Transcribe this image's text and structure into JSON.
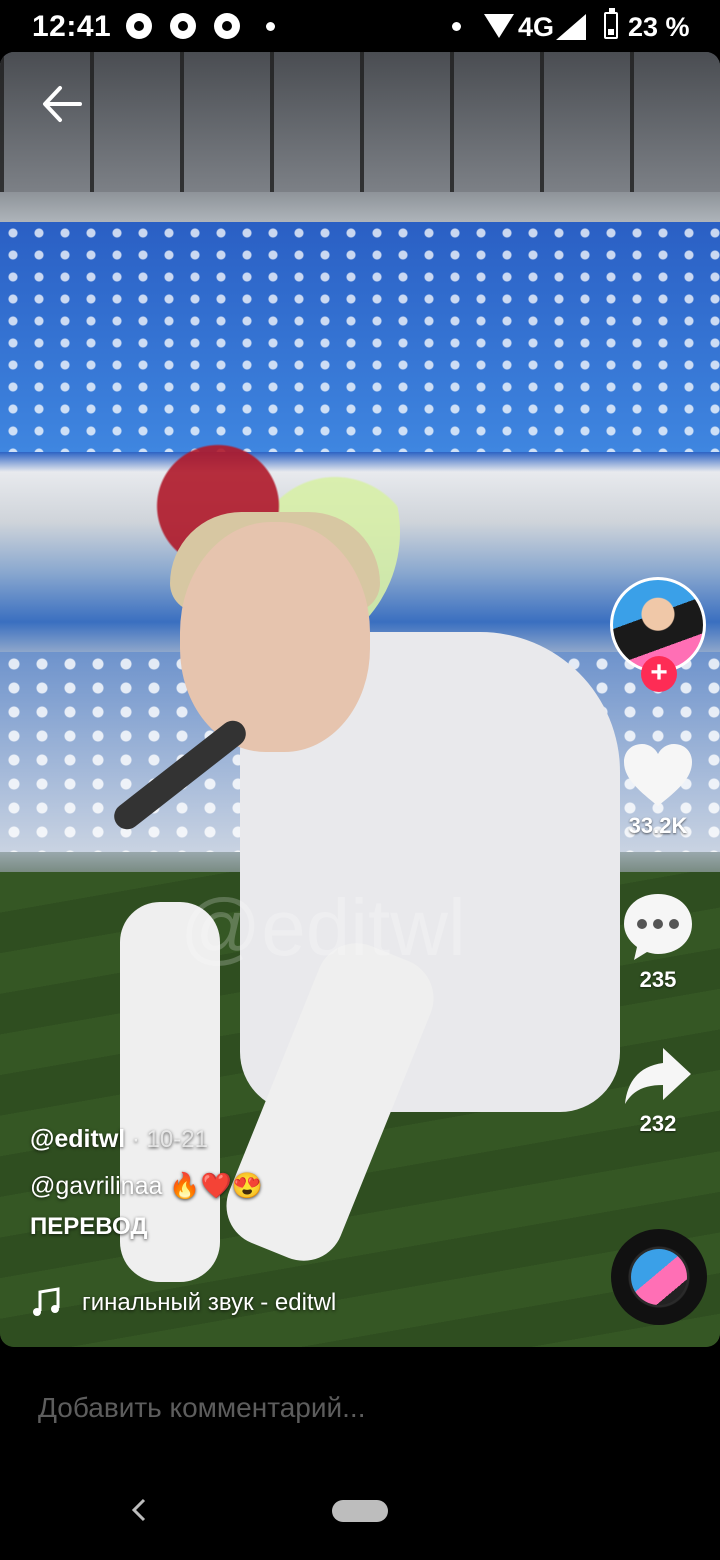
{
  "status_bar": {
    "time": "12:41",
    "network": "4G",
    "battery": "23 %"
  },
  "video": {
    "watermark": "@editwl",
    "likes": "33.2K",
    "comments": "235",
    "shares": "232",
    "author": "@editwl",
    "date_sep": " · ",
    "date": "10-21",
    "mention": "@gavrilinaa",
    "emojis": "🔥❤️😍",
    "translate_label": "ПЕРЕВОД",
    "sound": "гинальный звук - editwl"
  },
  "comment_bar": {
    "placeholder": "Добавить комментарий..."
  },
  "colors": {
    "accent": "#fe2c55",
    "background": "#000000",
    "placeholder": "#5d5d5d"
  },
  "icons": [
    "back-arrow-icon",
    "heart-icon",
    "comment-icon",
    "share-icon",
    "music-note-icon",
    "plus-icon",
    "chrome-icon"
  ]
}
